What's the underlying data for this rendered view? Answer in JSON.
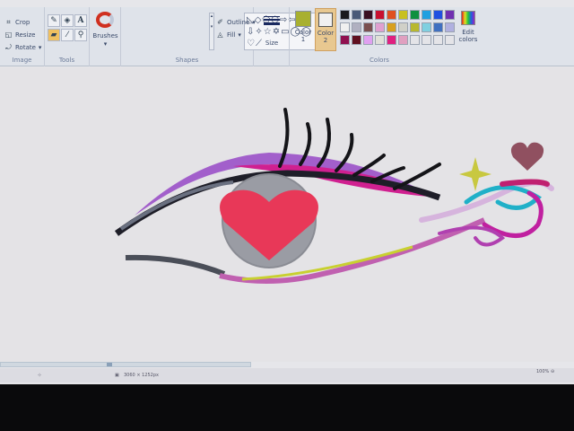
{
  "ribbon": {
    "image": {
      "label": "Image",
      "crop": "Crop",
      "resize": "Resize",
      "rotate": "Rotate"
    },
    "tools": {
      "label": "Tools",
      "items": [
        "pencil",
        "fill",
        "text",
        "eraser",
        "color-picker",
        "magnifier"
      ]
    },
    "brushes": {
      "label": "Brushes"
    },
    "shapes": {
      "label": "Shapes",
      "outline": "Outline",
      "fill": "Fill"
    },
    "size": {
      "label": "Size"
    },
    "colors": {
      "label": "Colors",
      "color1_label": "Color 1",
      "color2_label": "Color 2",
      "color1": "#a8b030",
      "color2": "#f0f0f0",
      "edit": "Edit colors",
      "palette": [
        "#1a1a1e",
        "#4a5a78",
        "#3a1022",
        "#c81030",
        "#e05020",
        "#c8c020",
        "#109040",
        "#20a0e0",
        "#2050e0",
        "#7030b0",
        "#f0f0f0",
        "#b0b0c0",
        "#7a5050",
        "#e0a0d0",
        "#d8a020",
        "#d0d0c8",
        "#b8b830",
        "#80d0e0",
        "#4070c0",
        "#b0b0e0",
        "#901050",
        "#601020",
        "#e0a0f0",
        "#e0e0d8",
        "#e02080",
        "#e0a0c0",
        "#e4e4e8",
        "#e4e4e8",
        "#e4e4e8",
        "#e4e4e8"
      ]
    }
  },
  "status": {
    "dimensions": "3060 × 1252px",
    "zoom": "100%"
  }
}
